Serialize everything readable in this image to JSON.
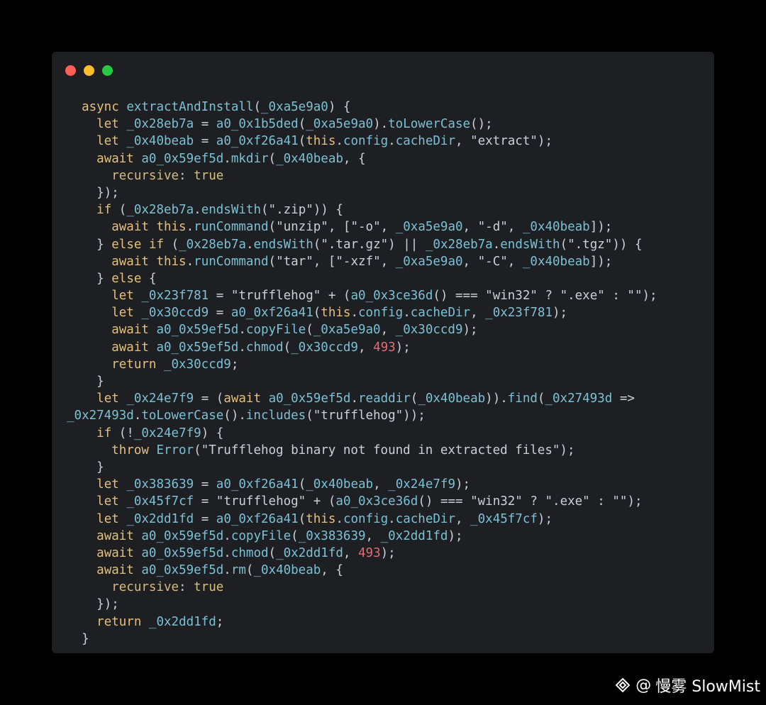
{
  "window": {
    "controls": [
      "close",
      "minimize",
      "maximize"
    ],
    "colors": {
      "close": "#ff5f57",
      "minimize": "#febc2e",
      "maximize": "#28c840",
      "background": "#1e1f22"
    }
  },
  "code_lines": [
    "  async extractAndInstall(_0xa5e9a0) {",
    "    let _0x28eb7a = a0_0x1b5ded(_0xa5e9a0).toLowerCase();",
    "    let _0x40beab = a0_0xf26a41(this.config.cacheDir, \"extract\");",
    "    await a0_0x59ef5d.mkdir(_0x40beab, {",
    "      recursive: true",
    "    });",
    "    if (_0x28eb7a.endsWith(\".zip\")) {",
    "      await this.runCommand(\"unzip\", [\"-o\", _0xa5e9a0, \"-d\", _0x40beab]);",
    "    } else if (_0x28eb7a.endsWith(\".tar.gz\") || _0x28eb7a.endsWith(\".tgz\")) {",
    "      await this.runCommand(\"tar\", [\"-xzf\", _0xa5e9a0, \"-C\", _0x40beab]);",
    "    } else {",
    "      let _0x23f781 = \"trufflehog\" + (a0_0x3ce36d() === \"win32\" ? \".exe\" : \"\");",
    "      let _0x30ccd9 = a0_0xf26a41(this.config.cacheDir, _0x23f781);",
    "      await a0_0x59ef5d.copyFile(_0xa5e9a0, _0x30ccd9);",
    "      await a0_0x59ef5d.chmod(_0x30ccd9, 493);",
    "      return _0x30ccd9;",
    "    }",
    "    let _0x24e7f9 = (await a0_0x59ef5d.readdir(_0x40beab)).find(_0x27493d =>",
    "_0x27493d.toLowerCase().includes(\"trufflehog\"));",
    "    if (!_0x24e7f9) {",
    "      throw Error(\"Trufflehog binary not found in extracted files\");",
    "    }",
    "    let _0x383639 = a0_0xf26a41(_0x40beab, _0x24e7f9);",
    "    let _0x45f7cf = \"trufflehog\" + (a0_0x3ce36d() === \"win32\" ? \".exe\" : \"\");",
    "    let _0x2dd1fd = a0_0xf26a41(this.config.cacheDir, _0x45f7cf);",
    "    await a0_0x59ef5d.copyFile(_0x383639, _0x2dd1fd);",
    "    await a0_0x59ef5d.chmod(_0x2dd1fd, 493);",
    "    await a0_0x59ef5d.rm(_0x40beab, {",
    "      recursive: true",
    "    });",
    "    return _0x2dd1fd;",
    "  }"
  ],
  "watermark": {
    "icon": "binance-square-icon",
    "at": "@",
    "text": "慢雾 SlowMist"
  }
}
